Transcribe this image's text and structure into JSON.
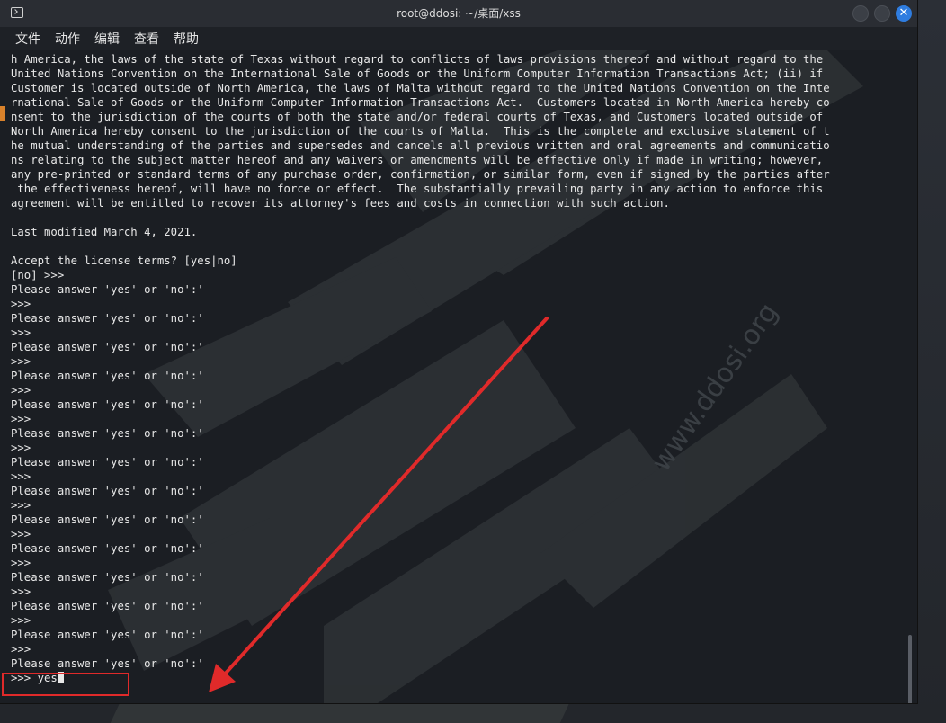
{
  "window": {
    "title": "root@ddosi: ~/桌面/xss"
  },
  "menu": [
    "文件",
    "动作",
    "编辑",
    "查看",
    "帮助"
  ],
  "terminal": {
    "lines": [
      "h America, the laws of the state of Texas without regard to conflicts of laws provisions thereof and without regard to the",
      "United Nations Convention on the International Sale of Goods or the Uniform Computer Information Transactions Act; (ii) if",
      "Customer is located outside of North America, the laws of Malta without regard to the United Nations Convention on the Inte",
      "rnational Sale of Goods or the Uniform Computer Information Transactions Act.  Customers located in North America hereby co",
      "nsent to the jurisdiction of the courts of both the state and/or federal courts of Texas, and Customers located outside of",
      "North America hereby consent to the jurisdiction of the courts of Malta.  This is the complete and exclusive statement of t",
      "he mutual understanding of the parties and supersedes and cancels all previous written and oral agreements and communicatio",
      "ns relating to the subject matter hereof and any waivers or amendments will be effective only if made in writing; however,",
      "any pre-printed or standard terms of any purchase order, confirmation, or similar form, even if signed by the parties after",
      " the effectiveness hereof, will have no force or effect.  The substantially prevailing party in any action to enforce this",
      "agreement will be entitled to recover its attorney's fees and costs in connection with such action.",
      "",
      "Last modified March 4, 2021.",
      "",
      "Accept the license terms? [yes|no]",
      "[no] >>>",
      "Please answer 'yes' or 'no':'",
      ">>>",
      "Please answer 'yes' or 'no':'",
      ">>>",
      "Please answer 'yes' or 'no':'",
      ">>>",
      "Please answer 'yes' or 'no':'",
      ">>>",
      "Please answer 'yes' or 'no':'",
      ">>>",
      "Please answer 'yes' or 'no':'",
      ">>>",
      "Please answer 'yes' or 'no':'",
      ">>>",
      "Please answer 'yes' or 'no':'",
      ">>>",
      "Please answer 'yes' or 'no':'",
      ">>>",
      "Please answer 'yes' or 'no':'",
      ">>>",
      "Please answer 'yes' or 'no':'",
      ">>>",
      "Please answer 'yes' or 'no':'",
      ">>>",
      "Please answer 'yes' or 'no':'",
      ">>>",
      "Please answer 'yes' or 'no':'"
    ],
    "prompt": ">>> ",
    "input": "yes"
  },
  "watermark": {
    "text": "www.ddosi.org"
  },
  "colors": {
    "annotation": "#e02a2a",
    "close_button": "#2f7de0",
    "terminal_bg": "#1b1e23",
    "terminal_fg": "#e8e8e8"
  }
}
